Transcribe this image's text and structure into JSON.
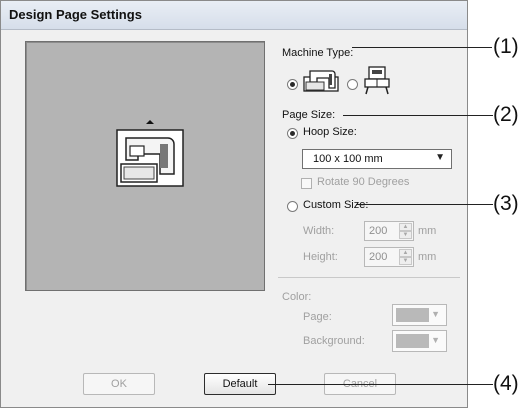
{
  "dialog": {
    "title": "Design Page Settings"
  },
  "machine_type": {
    "label": "Machine Type:",
    "selected": "sewing-embroidery-machine"
  },
  "page_size": {
    "label": "Page Size:",
    "hoop_size_label": "Hoop Size:",
    "hoop_value": "100 x 100 mm",
    "rotate_label": "Rotate 90 Degrees",
    "custom_size_label": "Custom Size:",
    "width_label": "Width:",
    "width_value": "200",
    "height_label": "Height:",
    "height_value": "200",
    "unit": "mm"
  },
  "color": {
    "label": "Color:",
    "page_label": "Page:",
    "background_label": "Background:"
  },
  "buttons": {
    "ok": "OK",
    "default": "Default",
    "cancel": "Cancel"
  },
  "callouts": [
    "(1)",
    "(2)",
    "(3)",
    "(4)"
  ]
}
